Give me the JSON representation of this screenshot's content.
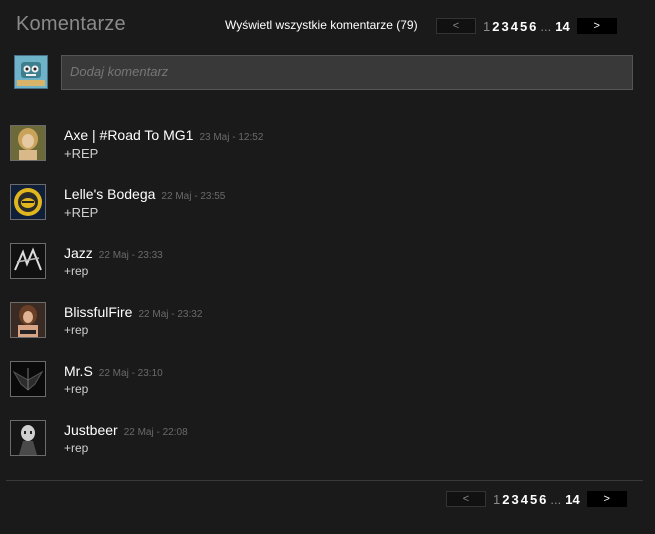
{
  "header": {
    "title": "Komentarze",
    "view_all": "Wyświetl wszystkie komentarze (79)"
  },
  "pager": {
    "prev": "<",
    "next": ">",
    "pages": [
      "1",
      "2",
      "3",
      "4",
      "5",
      "6"
    ],
    "dots": "...",
    "last": "14"
  },
  "composer": {
    "placeholder": "Dodaj komentarz"
  },
  "comments": [
    {
      "author": "Axe | #Road To MG1",
      "time": "23 Maj - 12:52",
      "text": "+REP",
      "avatar": "girl-portrait-avatar"
    },
    {
      "author": "Lelle's Bodega",
      "time": "22 Maj - 23:55",
      "text": "+REP",
      "avatar": "bee-emblem-avatar"
    },
    {
      "author": "Jazz",
      "time": "22 Maj - 23:33",
      "text": "+rep",
      "avatar": "jazz-graffiti-avatar"
    },
    {
      "author": "BlissfulFire",
      "time": "22 Maj - 23:32",
      "text": "+rep",
      "avatar": "woman-portrait-avatar"
    },
    {
      "author": "Mr.S",
      "time": "22 Maj - 23:10",
      "text": "+rep",
      "avatar": "dark-wings-avatar"
    },
    {
      "author": "Justbeer",
      "time": "22 Maj - 22:08",
      "text": "+rep",
      "avatar": "masked-figure-avatar"
    }
  ]
}
